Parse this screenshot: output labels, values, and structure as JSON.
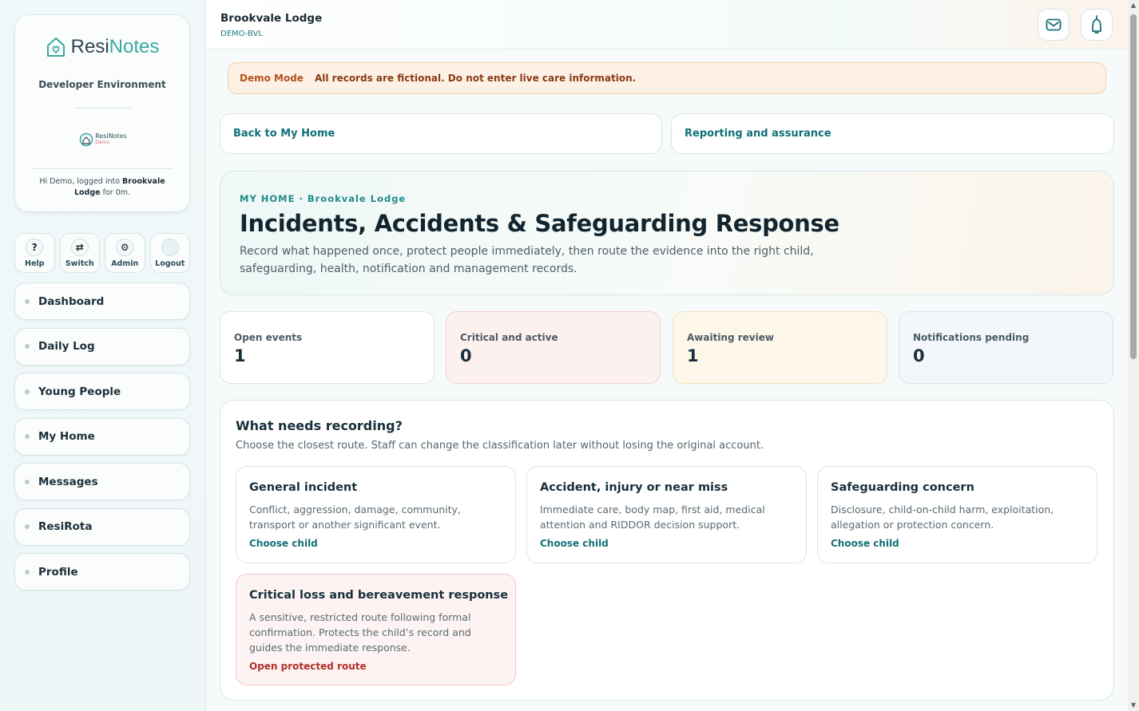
{
  "brand": {
    "name_part1": "Resi",
    "name_part2": "Notes",
    "environment": "Developer Environment",
    "mini_logo_name": "ResiNotes",
    "mini_logo_tag": "Demo"
  },
  "session": {
    "greeting_prefix": "Hi Demo, logged into ",
    "home": "Brookvale Lodge",
    "greeting_suffix": " for 0m."
  },
  "quick_actions": [
    {
      "label": "Help",
      "glyph": "?"
    },
    {
      "label": "Switch",
      "glyph": "⇄"
    },
    {
      "label": "Admin",
      "glyph": "⚙"
    },
    {
      "label": "Logout",
      "glyph": ""
    }
  ],
  "nav": [
    {
      "label": "Dashboard"
    },
    {
      "label": "Daily Log"
    },
    {
      "label": "Young People"
    },
    {
      "label": "My Home"
    },
    {
      "label": "Messages"
    },
    {
      "label": "ResiRota"
    },
    {
      "label": "Profile"
    }
  ],
  "header": {
    "home_name": "Brookvale Lodge",
    "home_code": "DEMO-BVL",
    "icons": [
      "mail-icon",
      "bell-icon"
    ]
  },
  "demo_banner": {
    "tag": "Demo Mode",
    "message": "All records are fictional. Do not enter live care information."
  },
  "links": {
    "back": "Back to My Home",
    "reporting": "Reporting and assurance"
  },
  "hero": {
    "eyebrow": "MY HOME · Brookvale Lodge",
    "title": "Incidents, Accidents & Safeguarding Response",
    "description": "Record what happened once, protect people immediately, then route the evidence into the right child, safeguarding, health, notification and management records."
  },
  "stats": [
    {
      "label": "Open events",
      "value": "1",
      "bg": "#ffffff",
      "border": "#d6e6e8"
    },
    {
      "label": "Critical and active",
      "value": "0",
      "bg": "#fdf1ef",
      "border": "#f1d2cd"
    },
    {
      "label": "Awaiting review",
      "value": "1",
      "bg": "#fdf7ea",
      "border": "#f1dfb9"
    },
    {
      "label": "Notifications pending",
      "value": "0",
      "bg": "#f3f6fb",
      "border": "#d9e2ec"
    }
  ],
  "recording": {
    "title": "What needs recording?",
    "subtitle": "Choose the closest route. Staff can change the classification later without losing the original account.",
    "routes": [
      {
        "title": "General incident",
        "description": "Conflict, aggression, damage, community, transport or another significant event.",
        "action": "Choose child"
      },
      {
        "title": "Accident, injury or near miss",
        "description": "Immediate care, body map, first aid, medical attention and RIDDOR decision support.",
        "action": "Choose child"
      },
      {
        "title": "Safeguarding concern",
        "description": "Disclosure, child-on-child harm, exploitation, allegation or protection concern.",
        "action": "Choose child"
      },
      {
        "title": "Critical loss and bereavement response",
        "description": "A sensitive, restricted route following formal confirmation. Protects the child’s record and guides the immediate response.",
        "action": "Open protected route"
      }
    ]
  }
}
